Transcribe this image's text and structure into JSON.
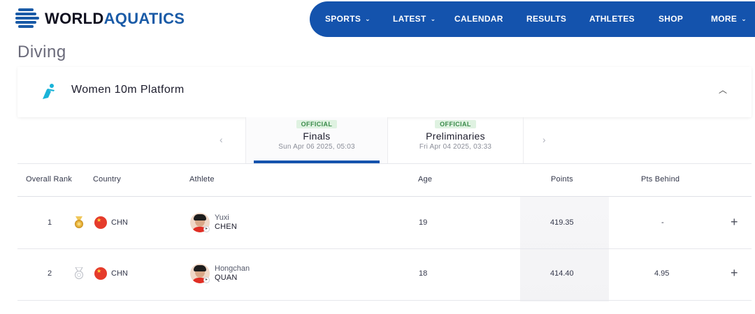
{
  "brand": {
    "word1": "WORLD",
    "word2": "AQUATICS",
    "color": "#1453ad"
  },
  "nav": {
    "items": [
      {
        "label": "SPORTS",
        "dropdown": true
      },
      {
        "label": "LATEST",
        "dropdown": true
      },
      {
        "label": "CALENDAR",
        "dropdown": false
      },
      {
        "label": "RESULTS",
        "dropdown": false
      },
      {
        "label": "ATHLETES",
        "dropdown": false
      },
      {
        "label": "SHOP",
        "dropdown": false
      },
      {
        "label": "MORE",
        "dropdown": true
      }
    ]
  },
  "page": {
    "title": "Diving"
  },
  "event": {
    "name": "Women 10m Platform",
    "icon": "diving-icon",
    "collapse_icon": "chevron-up-icon"
  },
  "tabs": [
    {
      "badge": "OFFICIAL",
      "title": "Finals",
      "date": "Sun Apr 06 2025, 05:03",
      "active": true
    },
    {
      "badge": "OFFICIAL",
      "title": "Preliminaries",
      "date": "Fri Apr 04 2025, 03:33",
      "active": false
    }
  ],
  "table": {
    "headers": {
      "rank": "Overall Rank",
      "country": "Country",
      "athlete": "Athlete",
      "age": "Age",
      "points": "Points",
      "behind": "Pts Behind"
    },
    "rows": [
      {
        "rank": "1",
        "medal": "gold-medal-icon",
        "country": "CHN",
        "first_name": "Yuxi",
        "last_name": "CHEN",
        "age": "19",
        "points": "419.35",
        "behind": "-"
      },
      {
        "rank": "2",
        "medal": "silver-medal-icon",
        "country": "CHN",
        "first_name": "Hongchan",
        "last_name": "QUAN",
        "age": "18",
        "points": "414.40",
        "behind": "4.95"
      }
    ],
    "expand_label": "+"
  },
  "colors": {
    "official_badge_bg": "#dff2e1",
    "official_badge_text": "#3a8b4a",
    "gold": "#e8b23a",
    "silver": "#b9bcc4",
    "flag_red": "#e53b2b"
  }
}
